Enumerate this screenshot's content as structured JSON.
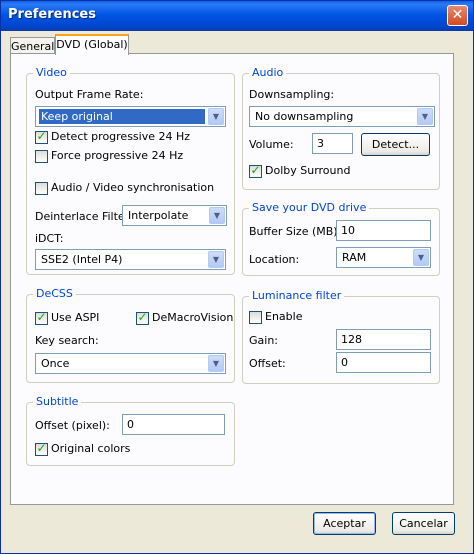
{
  "window": {
    "title": "Preferences",
    "close_glyph": "✕"
  },
  "tabs": [
    {
      "label": "General"
    },
    {
      "label": "DVD (Global)"
    }
  ],
  "video": {
    "legend": "Video",
    "frame_rate_label": "Output Frame Rate:",
    "frame_rate_value": "Keep original",
    "detect_24": {
      "label": "Detect progressive 24 Hz",
      "checked": true
    },
    "force_24": {
      "label": "Force progressive 24 Hz",
      "checked": false
    },
    "av_sync": {
      "label": "Audio / Video synchronisation",
      "checked": false
    },
    "deinterlace_label": "Deinterlace Filter:",
    "deinterlace_value": "Interpolate",
    "idct_label": "iDCT:",
    "idct_value": "SSE2 (Intel P4)"
  },
  "audio": {
    "legend": "Audio",
    "downsampling_label": "Downsampling:",
    "downsampling_value": "No downsampling",
    "volume_label": "Volume:",
    "volume_value": "3",
    "detect_button": "Detect...",
    "dolby": {
      "label": "Dolby Surround",
      "checked": true
    }
  },
  "dvd_drive": {
    "legend": "Save your DVD drive",
    "buffer_label": "Buffer Size (MB):",
    "buffer_value": "10",
    "location_label": "Location:",
    "location_value": "RAM"
  },
  "decss": {
    "legend": "DeCSS",
    "use_aspi": {
      "label": "Use ASPI",
      "checked": true
    },
    "demacrovision": {
      "label": "DeMacroVision",
      "checked": true
    },
    "key_search_label": "Key search:",
    "key_search_value": "Once"
  },
  "luminance": {
    "legend": "Luminance filter",
    "enable": {
      "label": "Enable",
      "checked": false
    },
    "gain_label": "Gain:",
    "gain_value": "128",
    "offset_label": "Offset:",
    "offset_value": "0"
  },
  "subtitle": {
    "legend": "Subtitle",
    "offset_label": "Offset (pixel):",
    "offset_value": "0",
    "original_colors": {
      "label": "Original colors",
      "checked": true
    }
  },
  "footer": {
    "ok_label": "Aceptar",
    "cancel_label": "Cancelar"
  },
  "glyphs": {
    "dropdown_arrow": "▼",
    "check_mark": "✓"
  },
  "colors": {
    "title_bar": "#0055e5",
    "group_legend": "#0046d5",
    "selection": "#316ac5",
    "check_mark": "#21a121"
  }
}
